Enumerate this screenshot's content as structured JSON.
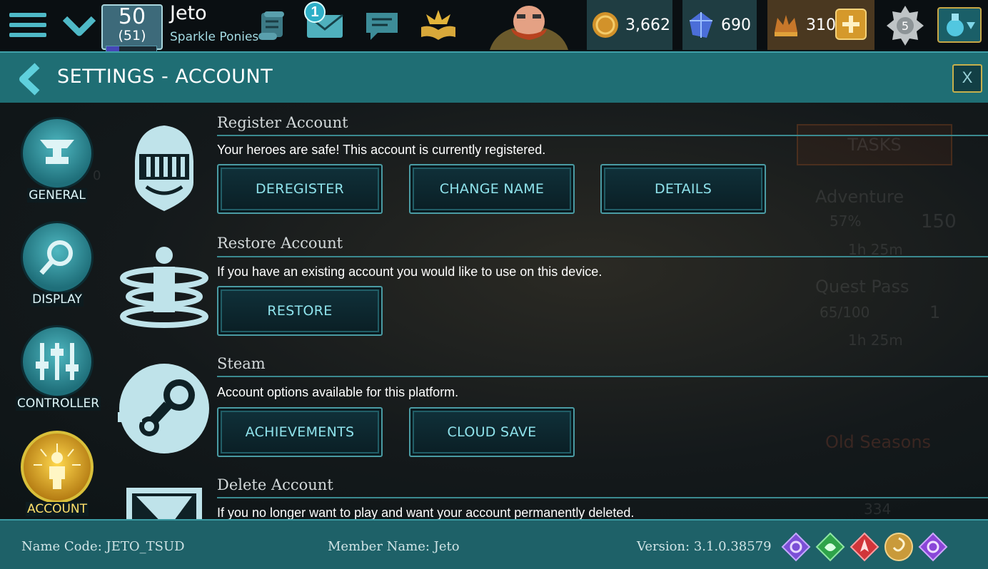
{
  "topbar": {
    "level": "50",
    "level_sub": "(51)",
    "xp_fraction": 0.25,
    "player_name": "Jeto",
    "guild_name": "Sparkle Ponies",
    "mail_badge": "1",
    "gold": "3,662",
    "gems": "690",
    "crowns": "310",
    "medal_rank": "5",
    "icons": [
      "menu-icon",
      "chevron-down-icon",
      "scroll-icon",
      "mail-icon",
      "chat-icon",
      "book-icon",
      "hero-portrait",
      "gold-coin-icon",
      "gem-icon",
      "crown-icon",
      "plus-icon",
      "medal-icon",
      "potion-icon"
    ]
  },
  "header": {
    "title": "SETTINGS - ACCOUNT",
    "close_label": "X"
  },
  "sidebar": {
    "items": [
      {
        "label": "GENERAL",
        "icon": "anvil-icon",
        "active": false
      },
      {
        "label": "DISPLAY",
        "icon": "magnifier-icon",
        "active": false
      },
      {
        "label": "CONTROLLER",
        "icon": "sliders-icon",
        "active": false
      },
      {
        "label": "ACCOUNT",
        "icon": "person-radiant-icon",
        "active": true
      }
    ]
  },
  "sections": {
    "register": {
      "title": "Register Account",
      "desc": "Your heroes are safe! This account is currently registered.",
      "buttons": [
        "DEREGISTER",
        "CHANGE NAME",
        "DETAILS"
      ]
    },
    "restore": {
      "title": "Restore Account",
      "desc": "If you have an existing account you would like to use on this device.",
      "buttons": [
        "RESTORE"
      ]
    },
    "steam": {
      "title": "Steam",
      "desc": "Account options available for this platform.",
      "buttons": [
        "ACHIEVEMENTS",
        "CLOUD SAVE"
      ]
    },
    "delete": {
      "title": "Delete Account",
      "desc": "If you no longer want to play and want your account permanently deleted."
    }
  },
  "background_ghost": {
    "tasks": "TASKS",
    "adventure": "Adventure",
    "adventure_pct": "57%",
    "adventure_num": "150",
    "adventure_time": "1h 25m",
    "quest_pass": "Quest Pass",
    "quest_progress": "65/100",
    "quest_num": "1",
    "quest_time": "1h 25m",
    "old_seasons": "Old Seasons",
    "old_seasons_num": "334",
    "level_ghost": "0"
  },
  "footer": {
    "name_code": "Name Code: JETO_TSUD",
    "member_name": "Member Name: Jeto",
    "version": "Version: 3.1.0.38579",
    "runes": [
      {
        "icon": "purple-rune-icon",
        "color": "#7b4fd6"
      },
      {
        "icon": "green-rune-icon",
        "color": "#2ea34a"
      },
      {
        "icon": "red-rune-icon",
        "color": "#d1353a"
      },
      {
        "icon": "gold-rune-icon",
        "color": "#c99a3a"
      },
      {
        "icon": "violet-rune-icon",
        "color": "#8a46d8"
      }
    ]
  },
  "colors": {
    "accent": "#1f6e74",
    "button_text": "#8fe3ec",
    "active_gold": "#d9c03a"
  }
}
